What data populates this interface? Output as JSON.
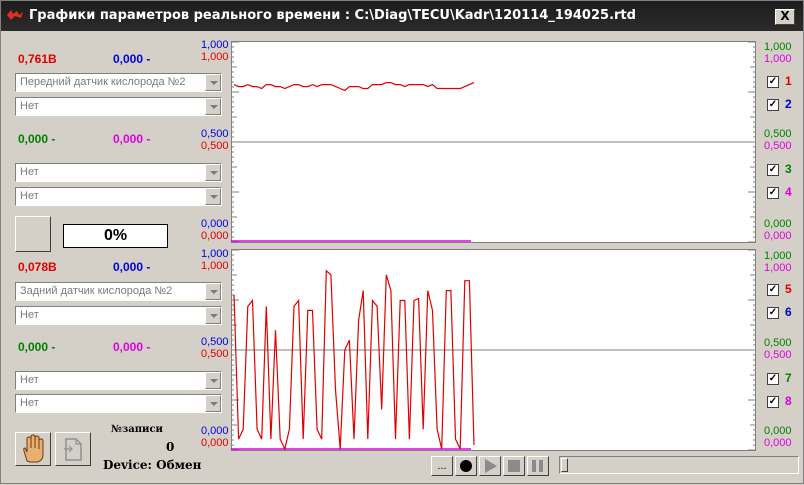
{
  "title": "Графики параметров реального времени : C:\\Diag\\TECU\\Kadr\\120114_194025.rtd",
  "close_label": "X",
  "group1": {
    "v1": "0,761В",
    "v2": "0,000 -",
    "sensor1": "Передний датчик кислорода №2",
    "sensor2": "Нет",
    "v3": "0,000 -",
    "v4": "0,000 -",
    "sensor3": "Нет",
    "sensor4": "Нет"
  },
  "percent": "0%",
  "group2": {
    "v1": "0,078В",
    "v2": "0,000 -",
    "sensor1": "Задний датчик кислорода №2",
    "sensor2": "Нет",
    "v3": "0,000 -",
    "v4": "0,000 -",
    "sensor3": "Нет",
    "sensor4": "Нет"
  },
  "rec_label": "№записи",
  "rec_num": "0",
  "device_label": "Device:",
  "device_status": "Обмен",
  "axis": {
    "top": "1,000",
    "mid": "0,500",
    "bot": "0,000"
  },
  "checkboxes": [
    "1",
    "2",
    "3",
    "4",
    "5",
    "6",
    "7",
    "8"
  ],
  "colors": {
    "c1": "#e00000",
    "c2": "#0000e0",
    "c3": "#008000",
    "c4": "#e000e0"
  },
  "controls": {
    "more": "...",
    "record": "record-icon",
    "play": "play-icon",
    "stop": "stop-icon",
    "pause": "pause-icon"
  },
  "chart_data": [
    {
      "type": "line",
      "series": [
        {
          "values": [
            0.79,
            0.78,
            0.78,
            0.79,
            0.78,
            0.78,
            0.77,
            0.79,
            0.79,
            0.78,
            0.78,
            0.77,
            0.78,
            0.79,
            0.79,
            0.78,
            0.78,
            0.79,
            0.78,
            0.79,
            0.79,
            0.79,
            0.78,
            0.77,
            0.76,
            0.78,
            0.78,
            0.78,
            0.77,
            0.77,
            0.79,
            0.79,
            0.79,
            0.8,
            0.8,
            0.79,
            0.79,
            0.78,
            0.79,
            0.79,
            0.79,
            0.79,
            0.78,
            0.79,
            0.77,
            0.77,
            0.77,
            0.77,
            0.77,
            0.77,
            0.78,
            0.79,
            0.8
          ]
        }
      ],
      "ylim": [
        0,
        1
      ]
    },
    {
      "type": "line",
      "series": [
        {
          "values": [
            0.78,
            0.05,
            0.1,
            0.72,
            0.75,
            0.1,
            0.05,
            0.72,
            0.05,
            0.6,
            0.05,
            0.0,
            0.1,
            0.72,
            0.75,
            0.05,
            0.7,
            0.7,
            0.1,
            0.05,
            0.9,
            0.88,
            0.3,
            0.0,
            0.5,
            0.55,
            0.05,
            0.65,
            0.8,
            0.05,
            0.75,
            0.72,
            0.2,
            0.88,
            0.8,
            0.05,
            0.75,
            0.75,
            0.05,
            0.75,
            0.76,
            0.1,
            0.8,
            0.7,
            0.1,
            0.0,
            0.8,
            0.8,
            0.05,
            0.0,
            0.85,
            0.85,
            0.02
          ]
        }
      ],
      "ylim": [
        0,
        1
      ]
    }
  ]
}
